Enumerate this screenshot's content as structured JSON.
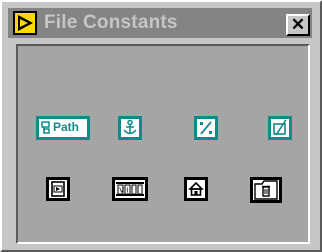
{
  "window": {
    "title": "File Constants",
    "close_glyph": "✕",
    "app_icon": "labview-run-icon"
  },
  "palette": {
    "row1": [
      {
        "name": "path-constant",
        "label": "Path",
        "icon": "path-icon"
      },
      {
        "name": "anchor-constant",
        "icon": "anchor-icon"
      },
      {
        "name": "path-separator-constant",
        "icon": "path-separator-icon"
      },
      {
        "name": "not-a-path-constant",
        "icon": "not-a-path-icon"
      }
    ],
    "row2": [
      {
        "name": "current-vi-path",
        "icon": "vi-path-icon"
      },
      {
        "name": "vi-library-directory",
        "icon": "vi-library-icon"
      },
      {
        "name": "default-directory",
        "icon": "home-directory-icon"
      },
      {
        "name": "temporary-directory",
        "icon": "trash-folder-icon"
      }
    ]
  },
  "colors": {
    "window_bg": "#c6c6c6",
    "titlebar_bg": "#848484",
    "panel_bg": "#a5a5a5",
    "teal_accent": "#128a8a",
    "title_text": "#c6c6c6"
  }
}
